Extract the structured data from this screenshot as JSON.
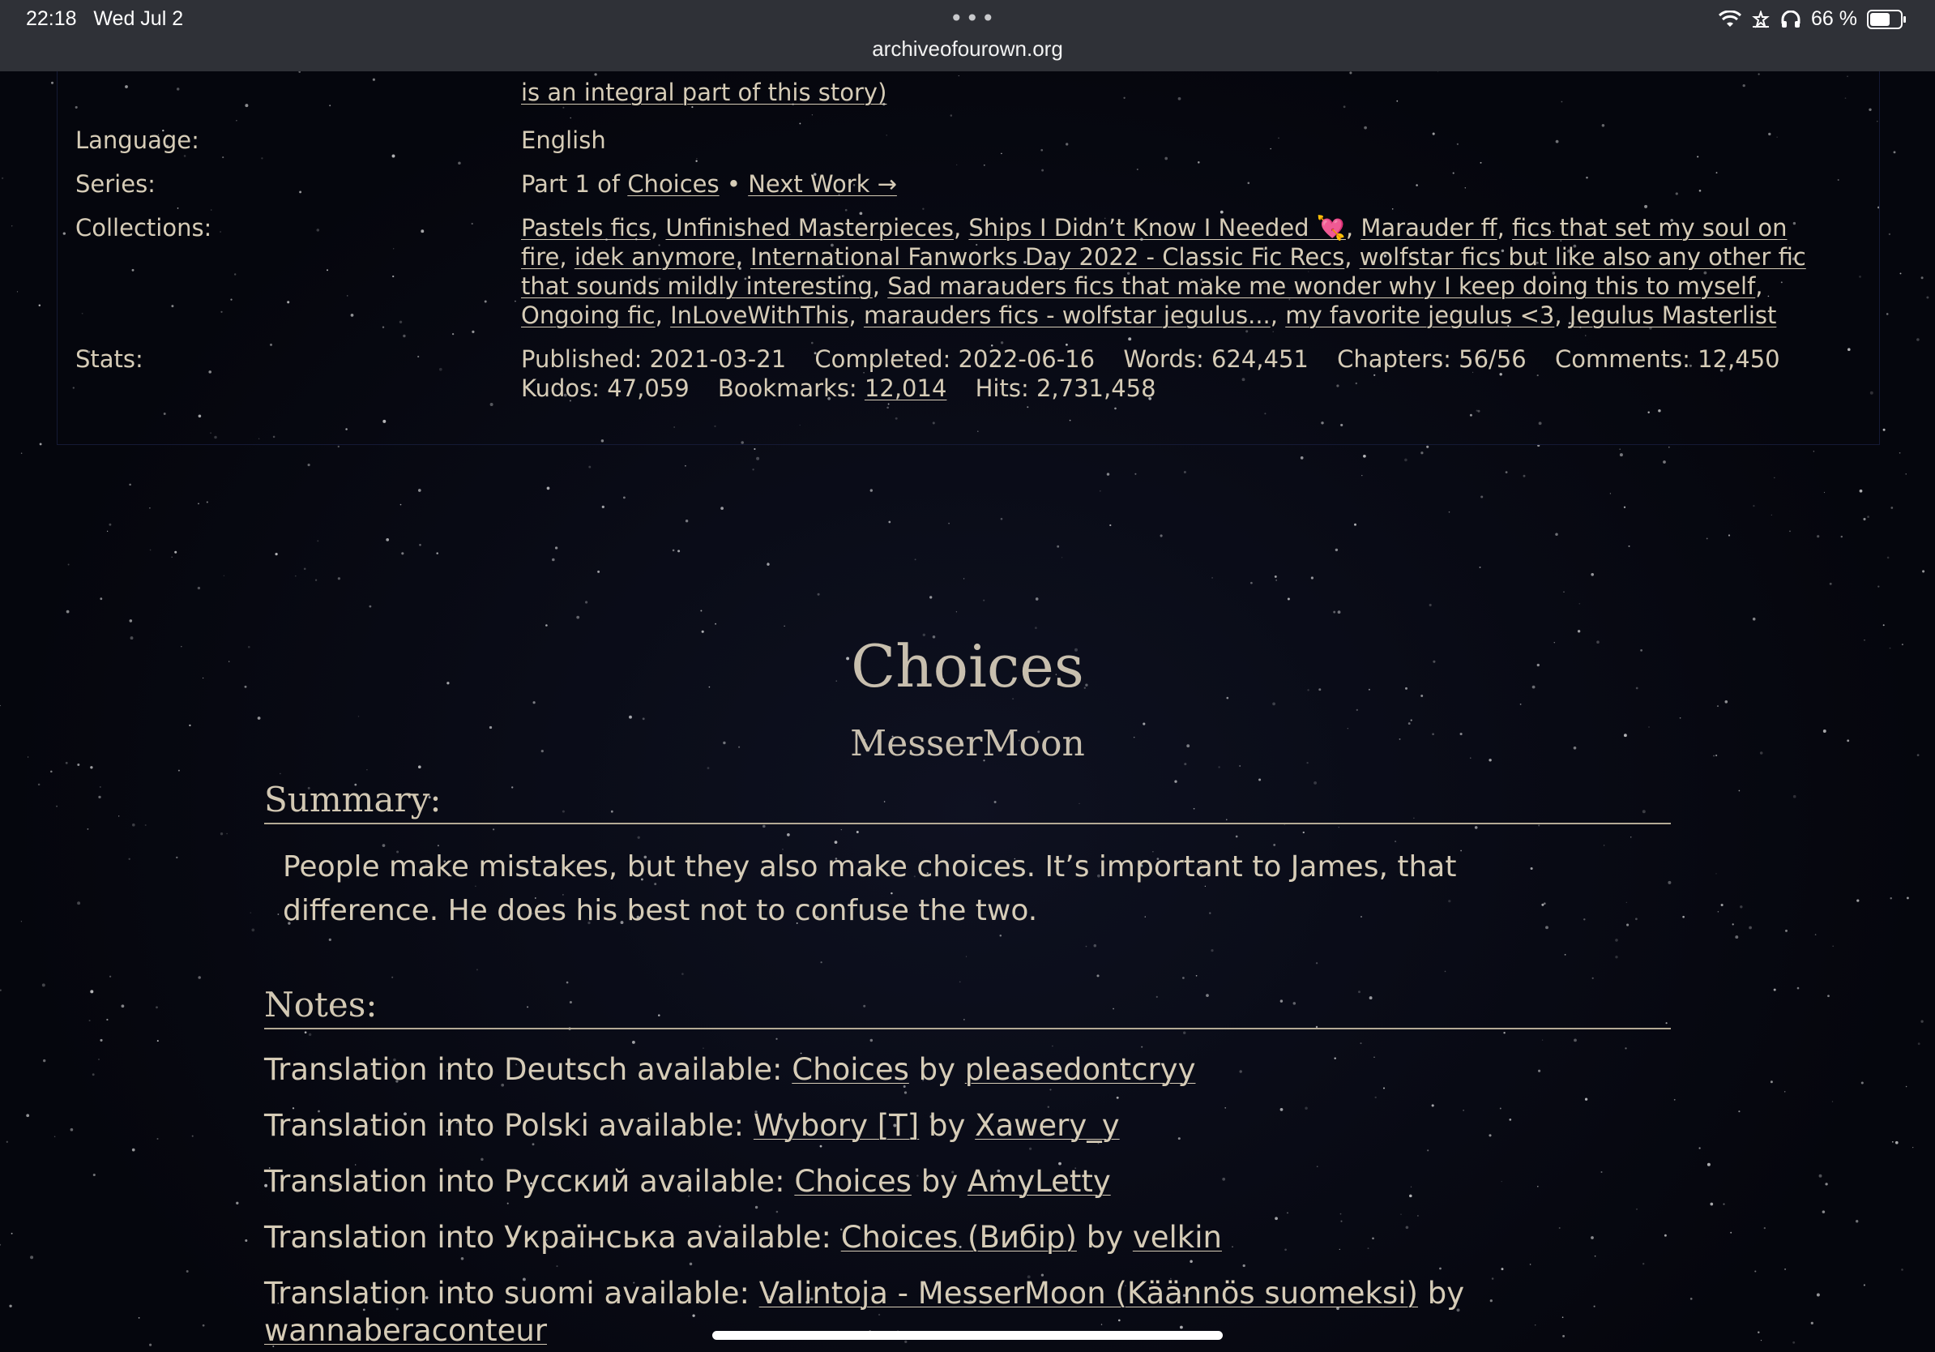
{
  "status_bar": {
    "time": "22:18",
    "date": "Wed Jul 2",
    "more": "•••",
    "url": "archiveofourown.org",
    "battery": "66 %",
    "battery_level": 0.66,
    "icons": [
      "wifi-icon",
      "do-not-disturb-icon",
      "headphones-icon",
      "battery-icon"
    ]
  },
  "meta": {
    "warning_tail": "is an integral part of this story)",
    "language_label": "Language:",
    "language_value": "English",
    "series_label": "Series:",
    "series_part": "Part 1 of",
    "series_name": "Choices",
    "series_sep": "•",
    "series_next": "Next Work →",
    "collections_label": "Collections:",
    "collections": [
      "Pastels fics",
      "Unfinished Masterpieces",
      "Ships I Didn’t Know I Needed 💘",
      "Marauder ff",
      "fics that set my soul on fire",
      "idek anymore",
      "International Fanworks Day 2022 - Classic Fic Recs",
      "wolfstar fics but like also any other fic that sounds mildly interesting",
      "Sad marauders fics that make me wonder why I keep doing this to myself",
      "Ongoing fic",
      "InLoveWithThis",
      "marauders fics - wolfstar jegulus...",
      "my favorite jegulus <3",
      "Jegulus Masterlist"
    ],
    "stats_label": "Stats:",
    "stats": {
      "published_label": "Published:",
      "published": "2021-03-21",
      "completed_label": "Completed:",
      "completed": "2022-06-16",
      "words_label": "Words:",
      "words": "624,451",
      "chapters_label": "Chapters:",
      "chapters": "56/56",
      "comments_label": "Comments:",
      "comments": "12,450",
      "kudos_label": "Kudos:",
      "kudos": "47,059",
      "bookmarks_label": "Bookmarks:",
      "bookmarks": "12,014",
      "hits_label": "Hits:",
      "hits": "2,731,458"
    }
  },
  "work": {
    "title": "Choices",
    "author": "MesserMoon",
    "summary_heading": "Summary:",
    "summary": "People make mistakes, but they also make choices. It’s important to James, that difference. He does his best not to confuse the two.",
    "notes_heading": "Notes:",
    "translations": [
      {
        "prefix": "Translation into Deutsch available:",
        "title": "Choices",
        "by": "by",
        "translator": "pleasedontcryy"
      },
      {
        "prefix": "Translation into Polski available:",
        "title": "Wybory [T]",
        "by": "by",
        "translator": "Xawery_y"
      },
      {
        "prefix": "Translation into Русский available:",
        "title": "Choices",
        "by": "by",
        "translator": "AmyLetty"
      },
      {
        "prefix": "Translation into Українська available:",
        "title": "Choices (Вибір)",
        "by": "by",
        "translator": "velkin"
      },
      {
        "prefix": "Translation into suomi available:",
        "title": "Valintoja - MesserMoon (Käännös suomeksi)",
        "by": "by",
        "translator": "wannaberaconteur"
      }
    ]
  }
}
